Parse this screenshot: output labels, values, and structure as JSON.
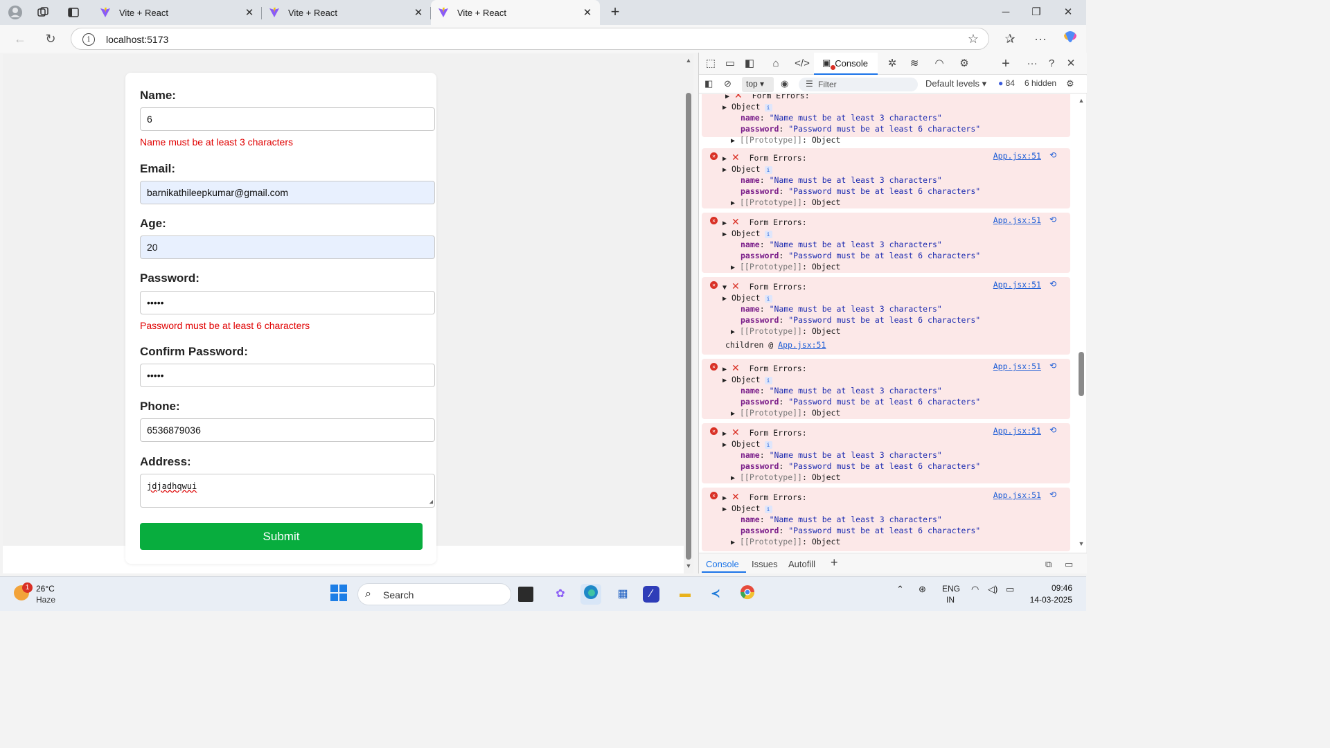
{
  "browser": {
    "tabs": [
      {
        "title": "Vite + React"
      },
      {
        "title": "Vite + React"
      },
      {
        "title": "Vite + React"
      }
    ],
    "url": "localhost:5173"
  },
  "form": {
    "name_label": "Name:",
    "name_value": "6",
    "name_error": "Name must be at least 3 characters",
    "email_label": "Email:",
    "email_value": "barnikathileepkumar@gmail.com",
    "age_label": "Age:",
    "age_value": "20",
    "password_label": "Password:",
    "password_value": "•••••",
    "password_error": "Password must be at least 6 characters",
    "confirm_label": "Confirm Password:",
    "confirm_value": "•••••",
    "phone_label": "Phone:",
    "phone_value": "6536879036",
    "address_label": "Address:",
    "address_value": "jdjadhqwui",
    "submit_label": "Submit"
  },
  "devtools": {
    "console_tab": "Console",
    "context": "top",
    "filter_placeholder": "Filter",
    "levels": "Default levels",
    "message_count": "84",
    "hidden": "6 hidden",
    "bottom_tabs": [
      "Console",
      "Issues",
      "Autofill"
    ],
    "entries": {
      "partial_title": "Form Errors:",
      "title": "Form Errors:",
      "object": "Object",
      "name_key": "name",
      "name_val": "\"Name must be at least 3 characters\"",
      "password_key": "password",
      "password_val": "\"Password must be at least 6 characters\"",
      "prototype": "[[Prototype]]",
      "prototype_val": "Object",
      "source": "App.jsx:51",
      "stack_prefix": "children @ ",
      "stack_link": "App.jsx:51"
    }
  },
  "taskbar": {
    "weather_badge": "1",
    "temperature": "26°C",
    "weather": "Haze",
    "search": "Search",
    "lang1": "ENG",
    "lang2": "IN",
    "time": "09:46",
    "date": "14-03-2025"
  },
  "colors": {
    "submit": "#08ad3e",
    "error_text": "#e00000",
    "error_bg": "#fce8e8",
    "accent": "#1a73e8"
  },
  "icons": [
    "profile-icon",
    "workspaces-icon",
    "tab-actions-icon",
    "vite-icon",
    "close-icon",
    "plus-icon",
    "minimize-icon",
    "restore-icon",
    "back-icon",
    "refresh-icon",
    "info-icon",
    "favorite-star-icon",
    "favorites-icon",
    "more-icon",
    "copilot-icon",
    "inspect-icon",
    "device-icon",
    "dock-icon",
    "home-icon",
    "sources-icon",
    "console-icon",
    "bug-icon",
    "network-icon",
    "performance-icon",
    "settings-icon",
    "help-icon",
    "sidebar-icon",
    "clear-icon",
    "eye-icon",
    "filter-icon",
    "gear-icon",
    "windows-icon",
    "search-icon"
  ]
}
